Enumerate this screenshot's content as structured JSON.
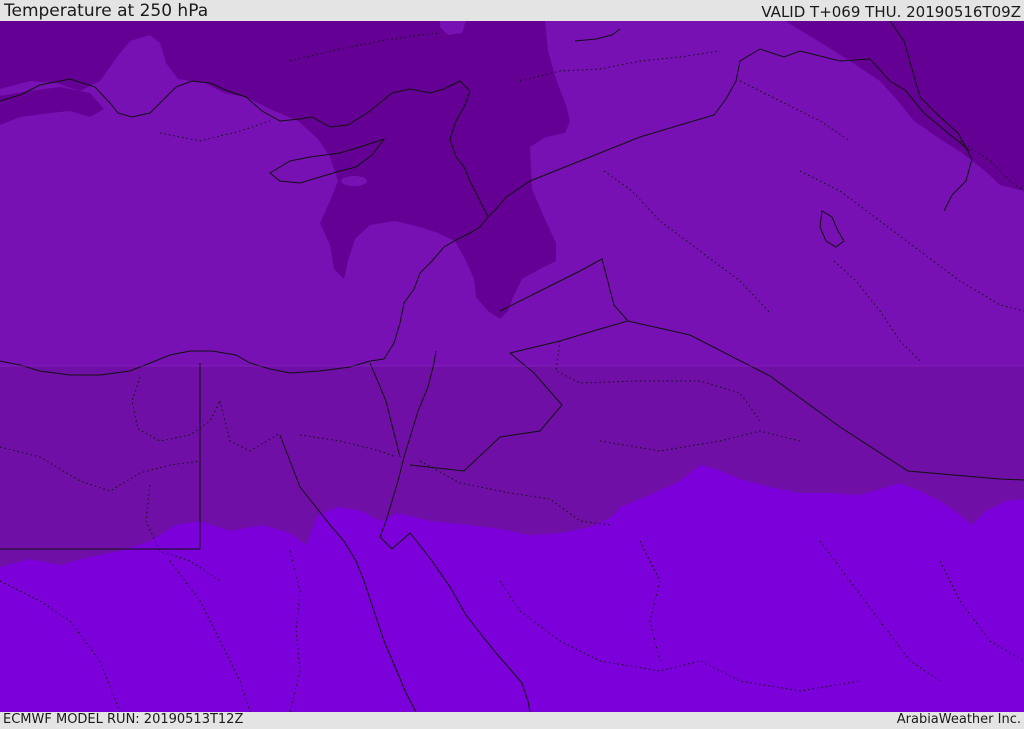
{
  "header": {
    "title": "Temperature at 250 hPa",
    "valid_time": "VALID T+069 THU. 20190516T09Z"
  },
  "footer": {
    "model_run": "ECMWF MODEL RUN: 20190513T12Z",
    "credit": "ArabiaWeather Inc."
  },
  "colors": {
    "band_cold": "#650095",
    "band_mid": "#7711b4",
    "band_warm": "#6f0fa6",
    "band_warmest": "#7b00d9",
    "coastline": "#111111",
    "borders": "#111111"
  }
}
